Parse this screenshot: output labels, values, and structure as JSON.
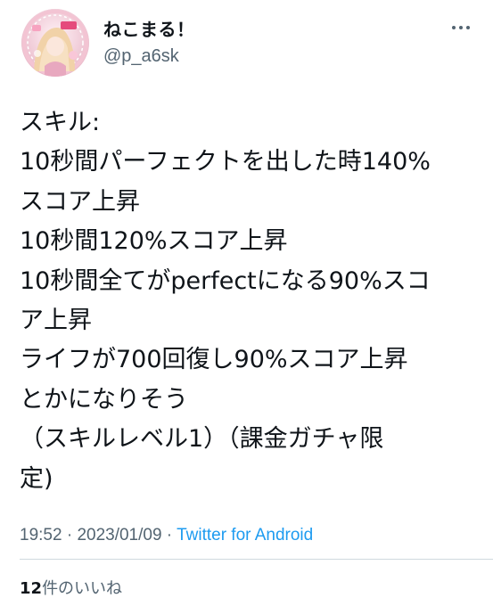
{
  "user": {
    "display_name": "ねこまる！",
    "handle": "@p_a6sk",
    "avatar_icon": "avatar-image"
  },
  "more_icon": "more-dots-icon",
  "tweet": {
    "lines": [
      "スキル:",
      "10秒間パーフェクトを出した時140%",
      "スコア上昇",
      "10秒間120%スコア上昇",
      "10秒間全てがperfectになる90%スコ",
      "ア上昇",
      "ライフが700回復し90%スコア上昇",
      "とかになりそう",
      "（スキルレベル1）（課金ガチャ限",
      "定)"
    ]
  },
  "meta": {
    "time": "19:52",
    "separator1": " · ",
    "date": "2023/01/09",
    "separator2": " · ",
    "source": "Twitter for Android"
  },
  "likes": {
    "count": "12",
    "label": "件のいいね"
  },
  "colors": {
    "text": "#0f1419",
    "secondary": "#536471",
    "link": "#1d9bf0",
    "divider": "#cfd9de"
  }
}
